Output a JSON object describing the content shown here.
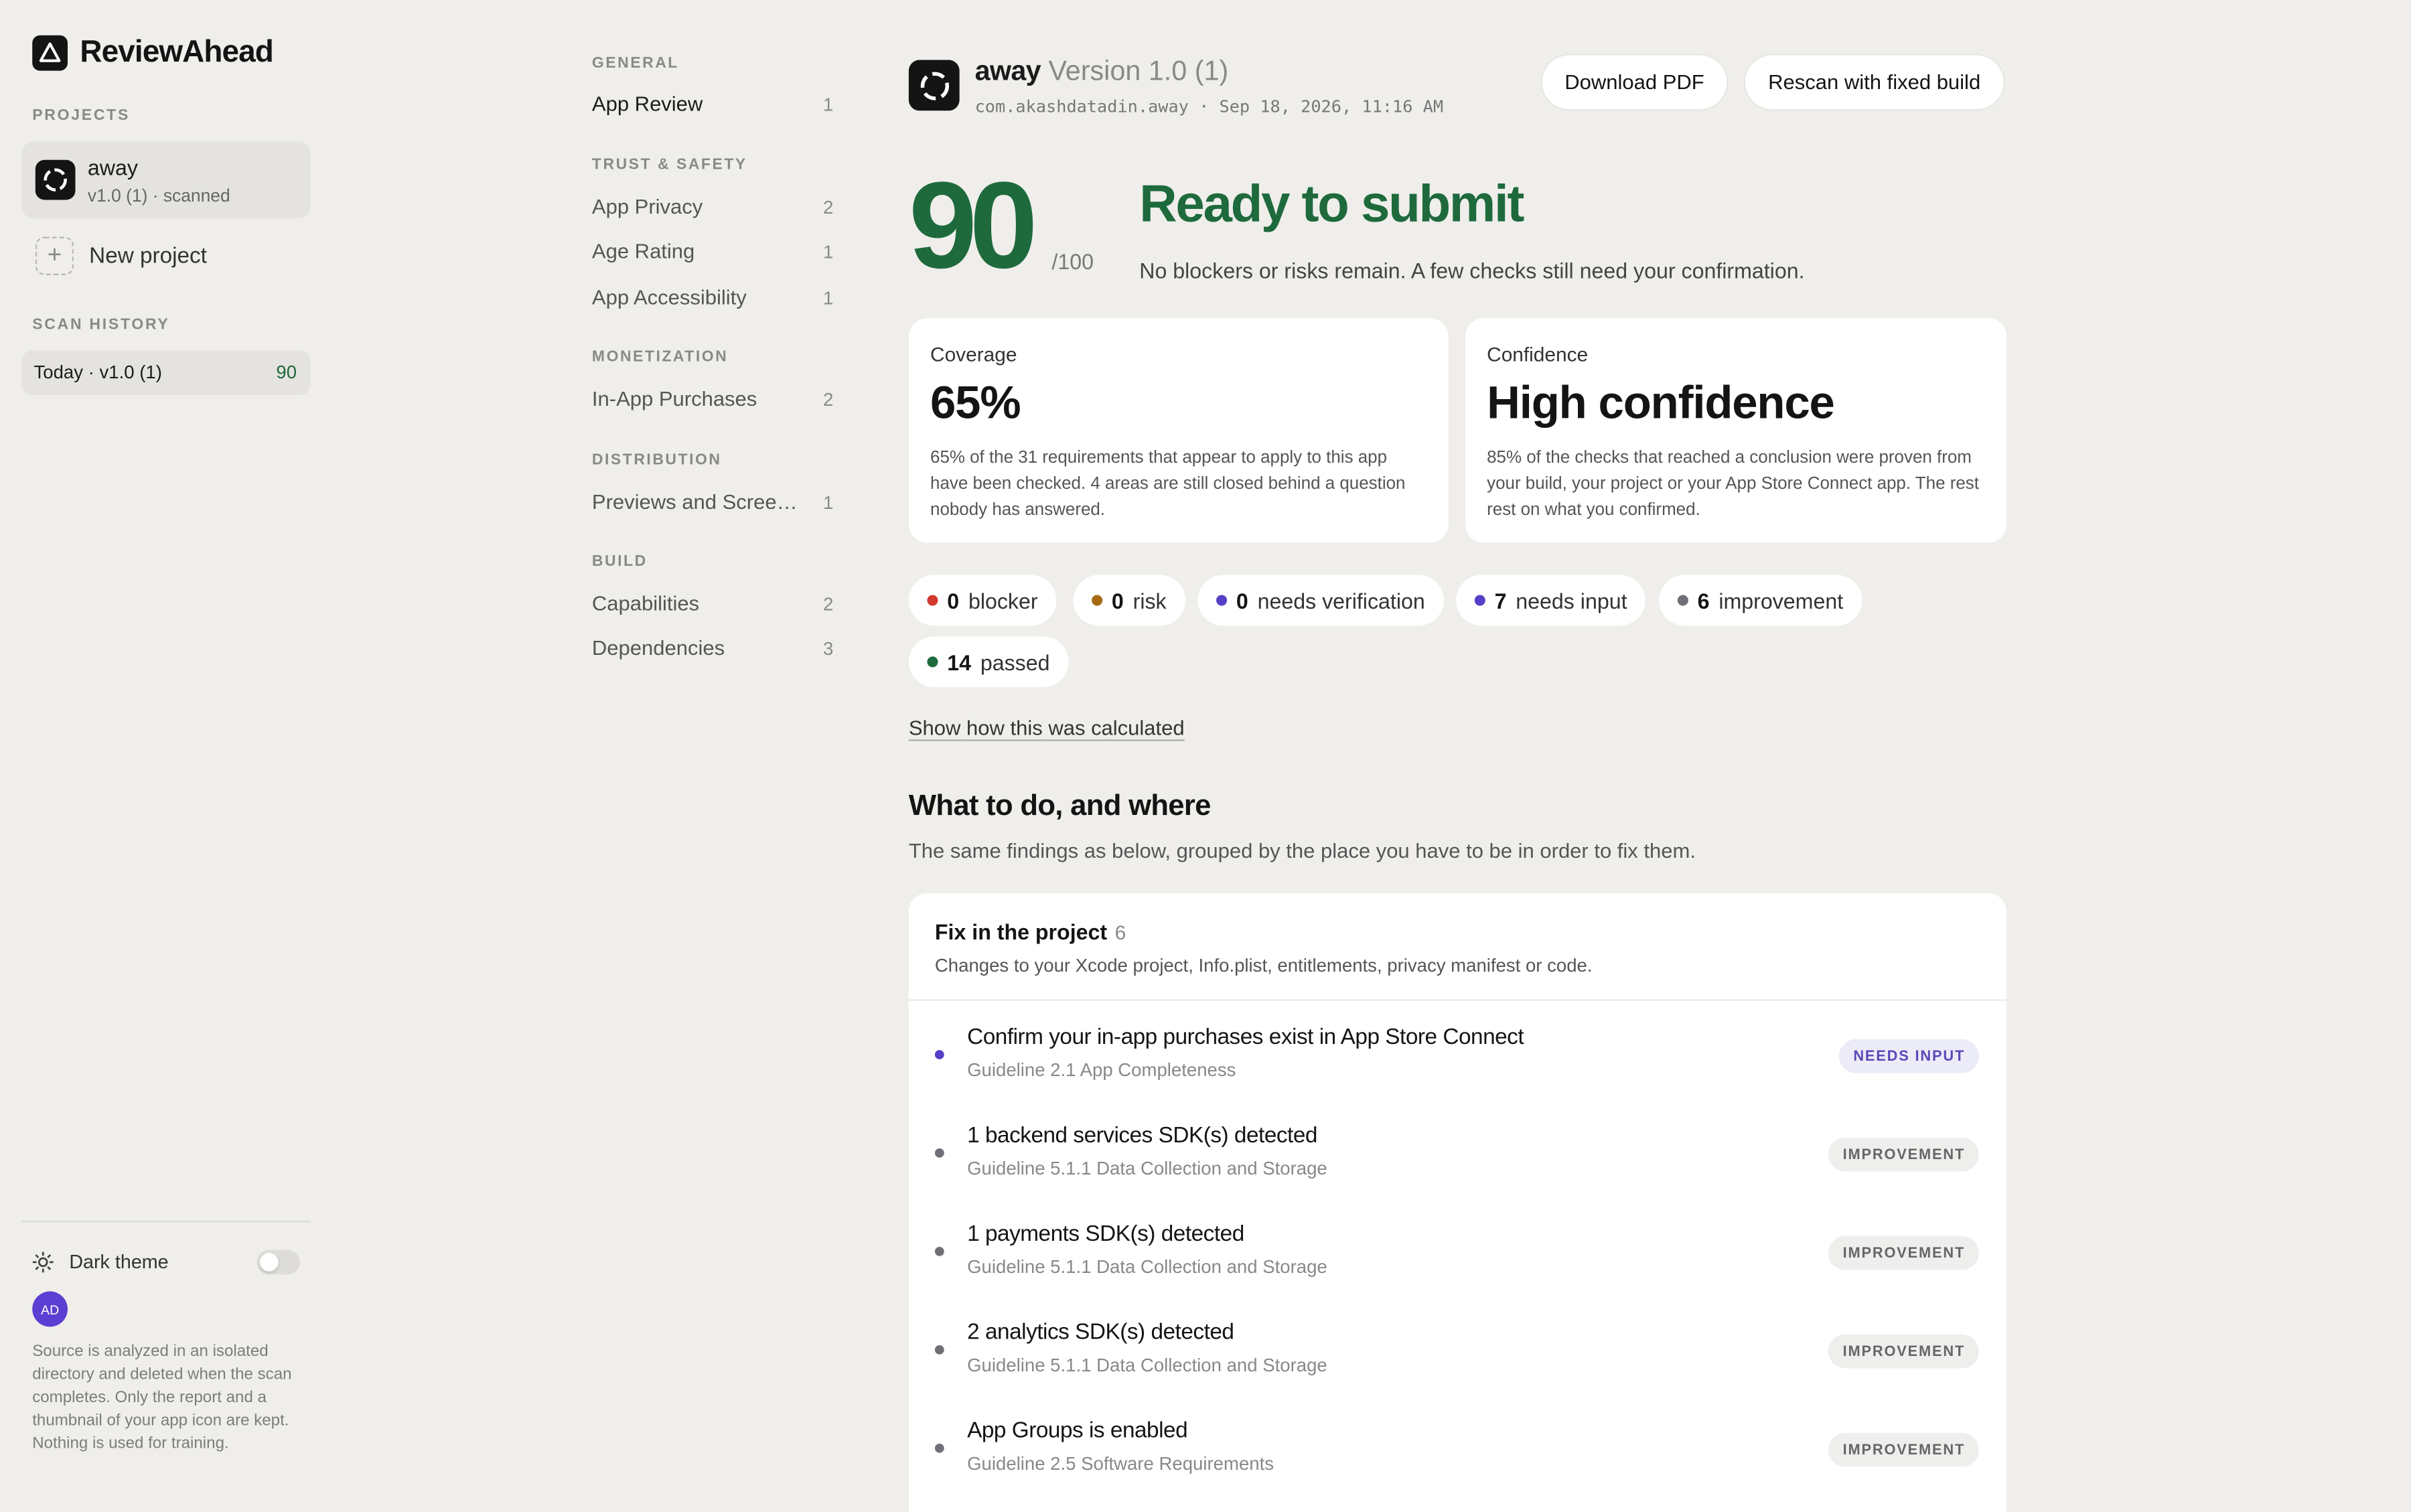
{
  "brand": {
    "name": "ReviewAhead"
  },
  "sidebar": {
    "projects_label": "PROJECTS",
    "project": {
      "name": "away",
      "subtitle": "v1.0 (1) · scanned"
    },
    "new_project_label": "New project",
    "history_label": "SCAN HISTORY",
    "history": [
      {
        "label": "Today · v1.0 (1)",
        "score": "90"
      }
    ],
    "theme_label": "Dark theme",
    "theme_on": false,
    "avatar_initials": "AD",
    "privacy_note": "Source is analyzed in an isolated directory and deleted when the scan completes. Only the report and a thumbnail of your app icon are kept. Nothing is used for training."
  },
  "nav": {
    "sections": [
      {
        "title": "GENERAL",
        "items": [
          {
            "label": "App Review",
            "count": "1",
            "active": true
          }
        ]
      },
      {
        "title": "TRUST & SAFETY",
        "items": [
          {
            "label": "App Privacy",
            "count": "2"
          },
          {
            "label": "Age Rating",
            "count": "1"
          },
          {
            "label": "App Accessibility",
            "count": "1"
          }
        ]
      },
      {
        "title": "MONETIZATION",
        "items": [
          {
            "label": "In-App Purchases",
            "count": "2"
          }
        ]
      },
      {
        "title": "DISTRIBUTION",
        "items": [
          {
            "label": "Previews and Screenshots",
            "count": "1"
          }
        ]
      },
      {
        "title": "BUILD",
        "items": [
          {
            "label": "Capabilities",
            "count": "2"
          },
          {
            "label": "Dependencies",
            "count": "3"
          }
        ]
      }
    ]
  },
  "header": {
    "app_name": "away",
    "version": "Version 1.0 (1)",
    "bundle_line": "com.akashdatadin.away · Sep 18, 2026, 11:16 AM",
    "download_label": "Download PDF",
    "rescan_label": "Rescan with fixed build"
  },
  "summary": {
    "score": "90",
    "score_max": "/100",
    "verdict": "Ready to submit",
    "verdict_sub": "No blockers or risks remain. A few checks still need your confirmation."
  },
  "cards": {
    "coverage": {
      "label": "Coverage",
      "value": "65%",
      "desc": "65% of the 31 requirements that appear to apply to this app have been checked. 4 areas are still closed behind a question nobody has answered."
    },
    "confidence": {
      "label": "Confidence",
      "value": "High confidence",
      "desc": "85% of the checks that reached a conclusion were proven from your build, your project or your App Store Connect app. The rest rest on what you confirmed."
    }
  },
  "counts": [
    {
      "num": "0",
      "label": "blocker",
      "color": "#d23a2e"
    },
    {
      "num": "0",
      "label": "risk",
      "color": "#a66a12"
    },
    {
      "num": "0",
      "label": "needs verification",
      "color": "#5340c6"
    },
    {
      "num": "7",
      "label": "needs input",
      "color": "#5340c6"
    },
    {
      "num": "6",
      "label": "improvement",
      "color": "#6f6f75"
    },
    {
      "num": "14",
      "label": "passed",
      "color": "#1e6a3c"
    }
  ],
  "calc_link": "Show how this was calculated",
  "todo": {
    "title": "What to do, and where",
    "subtitle": "The same findings as below, grouped by the place you have to be in order to fix them.",
    "group": {
      "title": "Fix in the project",
      "count": "6",
      "subtitle": "Changes to your Xcode project, Info.plist, entitlements, privacy manifest or code.",
      "items": [
        {
          "title": "Confirm your in-app purchases exist in App Store Connect",
          "guideline": "Guideline 2.1 App Completeness",
          "badge": "NEEDS INPUT",
          "kind": "input",
          "dot": "#5340c6"
        },
        {
          "title": "1 backend services SDK(s) detected",
          "guideline": "Guideline 5.1.1 Data Collection and Storage",
          "badge": "IMPROVEMENT",
          "kind": "impr",
          "dot": "#6f6f75"
        },
        {
          "title": "1 payments SDK(s) detected",
          "guideline": "Guideline 5.1.1 Data Collection and Storage",
          "badge": "IMPROVEMENT",
          "kind": "impr",
          "dot": "#6f6f75"
        },
        {
          "title": "2 analytics SDK(s) detected",
          "guideline": "Guideline 5.1.1 Data Collection and Storage",
          "badge": "IMPROVEMENT",
          "kind": "impr",
          "dot": "#6f6f75"
        },
        {
          "title": "App Groups is enabled",
          "guideline": "Guideline 2.5 Software Requirements",
          "badge": "IMPROVEMENT",
          "kind": "impr",
          "dot": "#6f6f75"
        }
      ]
    }
  },
  "icons": [
    "app-logo-icon",
    "app-ring-icon",
    "plus-icon",
    "sun-icon"
  ]
}
